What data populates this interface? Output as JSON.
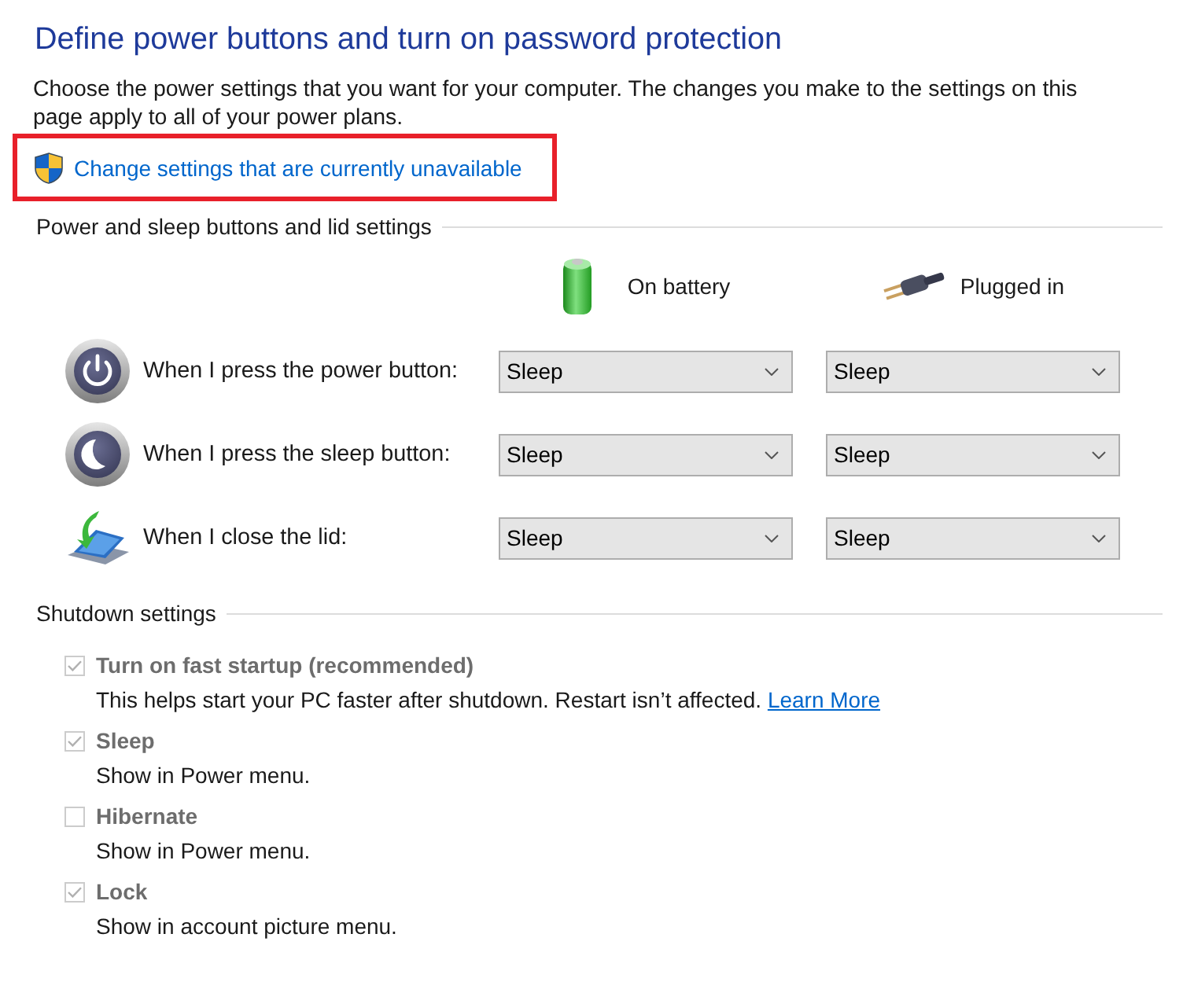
{
  "page": {
    "title": "Define power buttons and turn on password protection",
    "description": "Choose the power settings that you want for your computer. The changes you make to the settings on this page apply to all of your power plans."
  },
  "admin_link": {
    "label": "Change settings that are currently unavailable",
    "highlighted": true
  },
  "power_buttons": {
    "heading": "Power and sleep buttons and lid settings",
    "columns": [
      {
        "label": "On battery",
        "kind": "battery"
      },
      {
        "label": "Plugged in",
        "kind": "plug"
      }
    ],
    "rows": [
      {
        "label": "When I press the power button:",
        "kind": "power",
        "values": [
          "Sleep",
          "Sleep"
        ]
      },
      {
        "label": "When I press the sleep button:",
        "kind": "sleep",
        "values": [
          "Sleep",
          "Sleep"
        ]
      },
      {
        "label": "When I close the lid:",
        "kind": "lid",
        "values": [
          "Sleep",
          "Sleep"
        ]
      }
    ]
  },
  "shutdown": {
    "heading": "Shutdown settings",
    "options": [
      {
        "label": "Turn on fast startup (recommended)",
        "checked": true,
        "disabled": true,
        "description": "This helps start your PC faster after shutdown. Restart isn’t affected.",
        "link": "Learn More"
      },
      {
        "label": "Sleep",
        "checked": true,
        "disabled": true,
        "description": "Show in Power menu."
      },
      {
        "label": "Hibernate",
        "checked": false,
        "disabled": true,
        "description": "Show in Power menu."
      },
      {
        "label": "Lock",
        "checked": true,
        "disabled": true,
        "description": "Show in account picture menu."
      }
    ]
  }
}
